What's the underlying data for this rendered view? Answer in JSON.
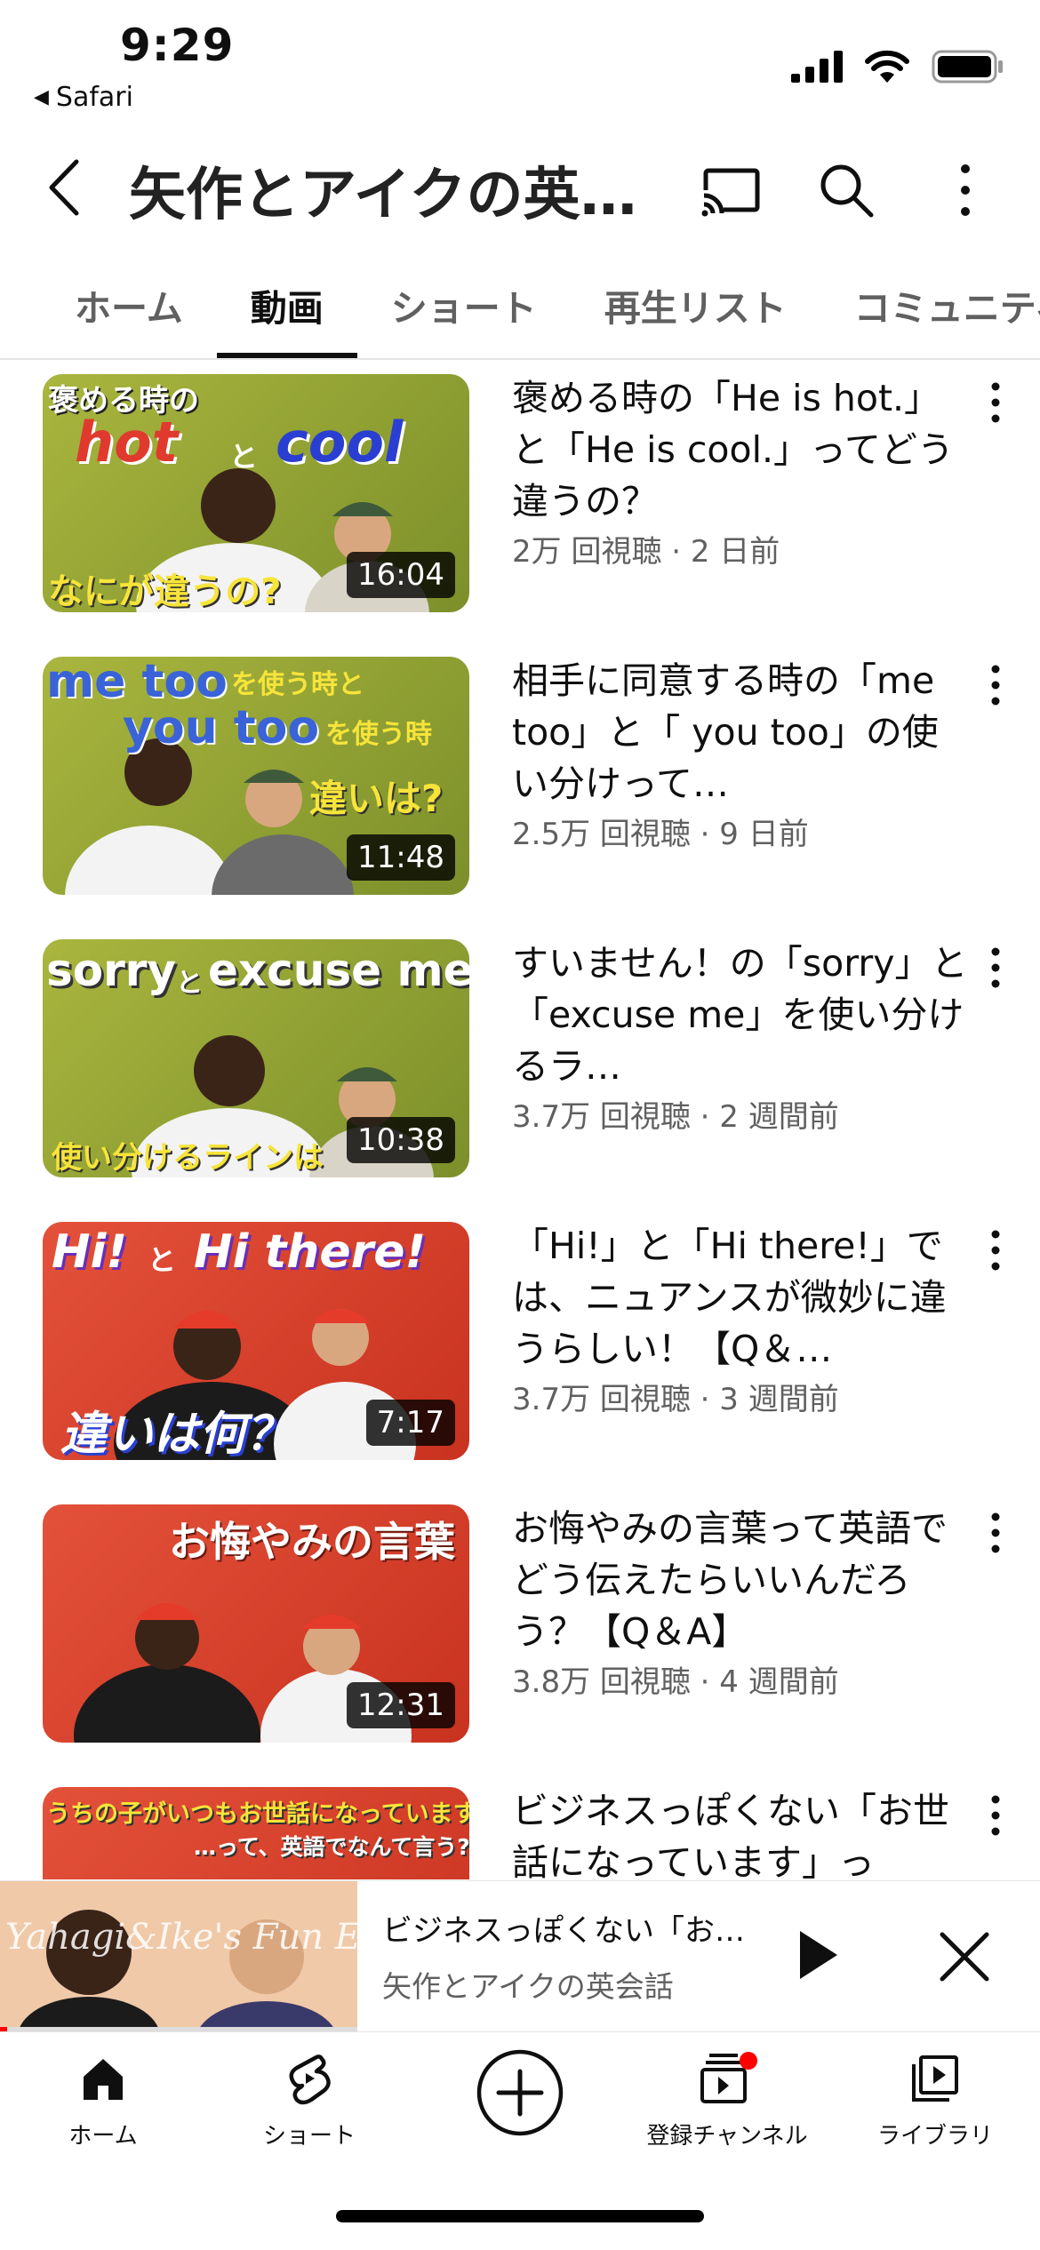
{
  "status_bar": {
    "time": "9:29",
    "back_app": "Safari"
  },
  "header": {
    "title": "矢作とアイクの英…"
  },
  "tabs": [
    {
      "label": "ホーム",
      "active": false
    },
    {
      "label": "動画",
      "active": true
    },
    {
      "label": "ショート",
      "active": false
    },
    {
      "label": "再生リスト",
      "active": false
    },
    {
      "label": "コミュニティ",
      "active": false
    }
  ],
  "videos": [
    {
      "title": "褒める時の「He is hot.」と「He is cool.」ってどう違うの？",
      "meta": "2万 回視聴 · 2 日前",
      "duration": "16:04",
      "thumb_texts": [
        "褒める時の",
        "hot",
        "と",
        "cool",
        "なにが違うの?"
      ]
    },
    {
      "title": "相手に同意する時の「me too」と「 you too」の使い分けって…",
      "meta": "2.5万 回視聴 · 9 日前",
      "duration": "11:48",
      "thumb_texts": [
        "me too",
        "を使う時と",
        "you too",
        "を使う時",
        "違いは?"
      ]
    },
    {
      "title": "すいません！の「sorry」と「excuse me」を使い分けるラ…",
      "meta": "3.7万 回視聴 · 2 週間前",
      "duration": "10:38",
      "thumb_texts": [
        "sorry",
        "と",
        "excuse me",
        "使い分けるラインは"
      ]
    },
    {
      "title": "「Hi!」と「Hi there!」では、ニュアンスが微妙に違うらしい！【Q＆…",
      "meta": "3.7万 回視聴 · 3 週間前",
      "duration": "7:17",
      "thumb_texts": [
        "Hi!",
        "と",
        "Hi there!",
        "違いは何？"
      ]
    },
    {
      "title": "お悔やみの言葉って英語でどう伝えたらいいんだろう？【Q＆A】",
      "meta": "3.8万 回視聴 · 4 週間前",
      "duration": "12:31",
      "thumb_texts": [
        "お悔やみの言葉"
      ]
    },
    {
      "title": "ビジネスっぽくない「お世話になっています」っ",
      "meta": "",
      "duration": "",
      "thumb_texts": [
        "うちの子がいつもお世話になっています",
        "…って、英語でなんて言う?"
      ]
    }
  ],
  "mini_player": {
    "title": "ビジネスっぽくない「お…",
    "channel": "矢作とアイクの英会話",
    "watermark": "Yahagi&Ike's Fun English",
    "progress": 0.02
  },
  "bottom_nav": [
    {
      "label": "ホーム",
      "icon": "home-icon"
    },
    {
      "label": "ショート",
      "icon": "shorts-icon"
    },
    {
      "label": "",
      "icon": "create-icon"
    },
    {
      "label": "登録チャンネル",
      "icon": "subscriptions-icon"
    },
    {
      "label": "ライブラリ",
      "icon": "library-icon"
    }
  ],
  "colors": {
    "accent_red": "#ff0000",
    "text_primary": "#0f0f0f",
    "text_secondary": "#606060"
  }
}
